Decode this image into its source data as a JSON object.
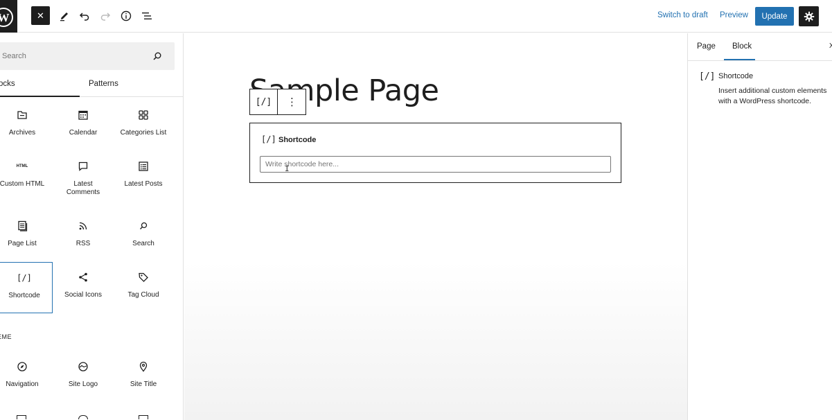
{
  "topbar": {
    "logo": "wordpress-logo",
    "close_label": "✕",
    "switch_to_draft": "Switch to draft",
    "preview": "Preview",
    "update": "Update"
  },
  "inserter": {
    "search_placeholder": "Search",
    "tabs": [
      "ocks",
      "Patterns"
    ],
    "blocks": [
      {
        "label": "Archives",
        "icon": "archive-icon"
      },
      {
        "label": "Calendar",
        "icon": "calendar-icon"
      },
      {
        "label": "Categories List",
        "icon": "categories-icon"
      },
      {
        "label": "Custom HTML",
        "icon": "html-icon"
      },
      {
        "label": "Latest Comments",
        "icon": "comment-icon"
      },
      {
        "label": "Latest Posts",
        "icon": "list-icon"
      },
      {
        "label": "Page List",
        "icon": "pages-icon"
      },
      {
        "label": "RSS",
        "icon": "rss-icon"
      },
      {
        "label": "Search",
        "icon": "search-icon"
      },
      {
        "label": "Shortcode",
        "icon": "shortcode-icon"
      },
      {
        "label": "Social Icons",
        "icon": "share-icon"
      },
      {
        "label": "Tag Cloud",
        "icon": "tag-icon"
      }
    ],
    "html_icon_text": "HTML",
    "theme_section_label": "EME",
    "theme_blocks": [
      {
        "label": "Navigation",
        "icon": "compass-icon"
      },
      {
        "label": "Site Logo",
        "icon": "site-logo-icon"
      },
      {
        "label": "Site Title",
        "icon": "map-pin-icon"
      }
    ]
  },
  "canvas": {
    "page_title": "Sample Page",
    "toolbar_icon": "[/]",
    "toolbar_more": "⋮",
    "shortcode_block": {
      "icon": "[/]",
      "label": "Shortcode",
      "placeholder": "Write shortcode here..."
    }
  },
  "sidebar": {
    "tabs": [
      "Page",
      "Block"
    ],
    "active_tab": "Block",
    "close": "X",
    "block_icon": "[/]",
    "block_title": "Shortcode",
    "block_description_line1": "Insert additional custom elements",
    "block_description_line2": "with a WordPress shortcode."
  },
  "colors": {
    "accent": "#2271b1",
    "dark": "#1e1e1e",
    "border": "#e0e0e0"
  }
}
